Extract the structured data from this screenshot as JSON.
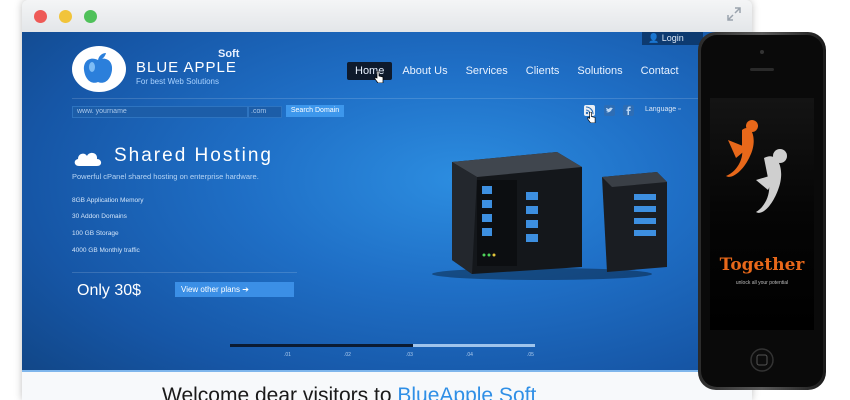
{
  "header": {
    "login_label": "Login",
    "brand_soft": "Soft",
    "brand_name": "BLUE APPLE",
    "tagline": "For best Web Solutions"
  },
  "nav": [
    {
      "label": "Home",
      "active": true
    },
    {
      "label": "About Us"
    },
    {
      "label": "Services"
    },
    {
      "label": "Clients"
    },
    {
      "label": "Solutions"
    },
    {
      "label": "Contact"
    }
  ],
  "domain_search": {
    "placeholder": "www.  yourname",
    "extension": ".com",
    "button_label": "Search Domain"
  },
  "social": [
    "rss-icon",
    "twitter-icon",
    "facebook-icon"
  ],
  "language_label": "Language",
  "hero": {
    "title": "Shared Hosting",
    "subtitle": "Powerful cPanel shared hosting on enterprise hardware.",
    "features": [
      "8GB Application Memory",
      "30 Addon Domains",
      "100 GB Storage",
      "4000 GB Monthly traffic"
    ],
    "price": "Only 30$",
    "plans_button": "View other plans"
  },
  "slider": {
    "labels": [
      ".01",
      ".02",
      ".03",
      ".04",
      ".05"
    ],
    "progress": 0.6
  },
  "welcome": {
    "prefix": "Welcome dear visitors to ",
    "accent": "BlueApple Soft"
  },
  "phone": {
    "brand": "Together",
    "tagline": "unlock all your potential"
  },
  "colors": {
    "accent": "#2f8fe6",
    "phone_orange": "#e8681a"
  }
}
